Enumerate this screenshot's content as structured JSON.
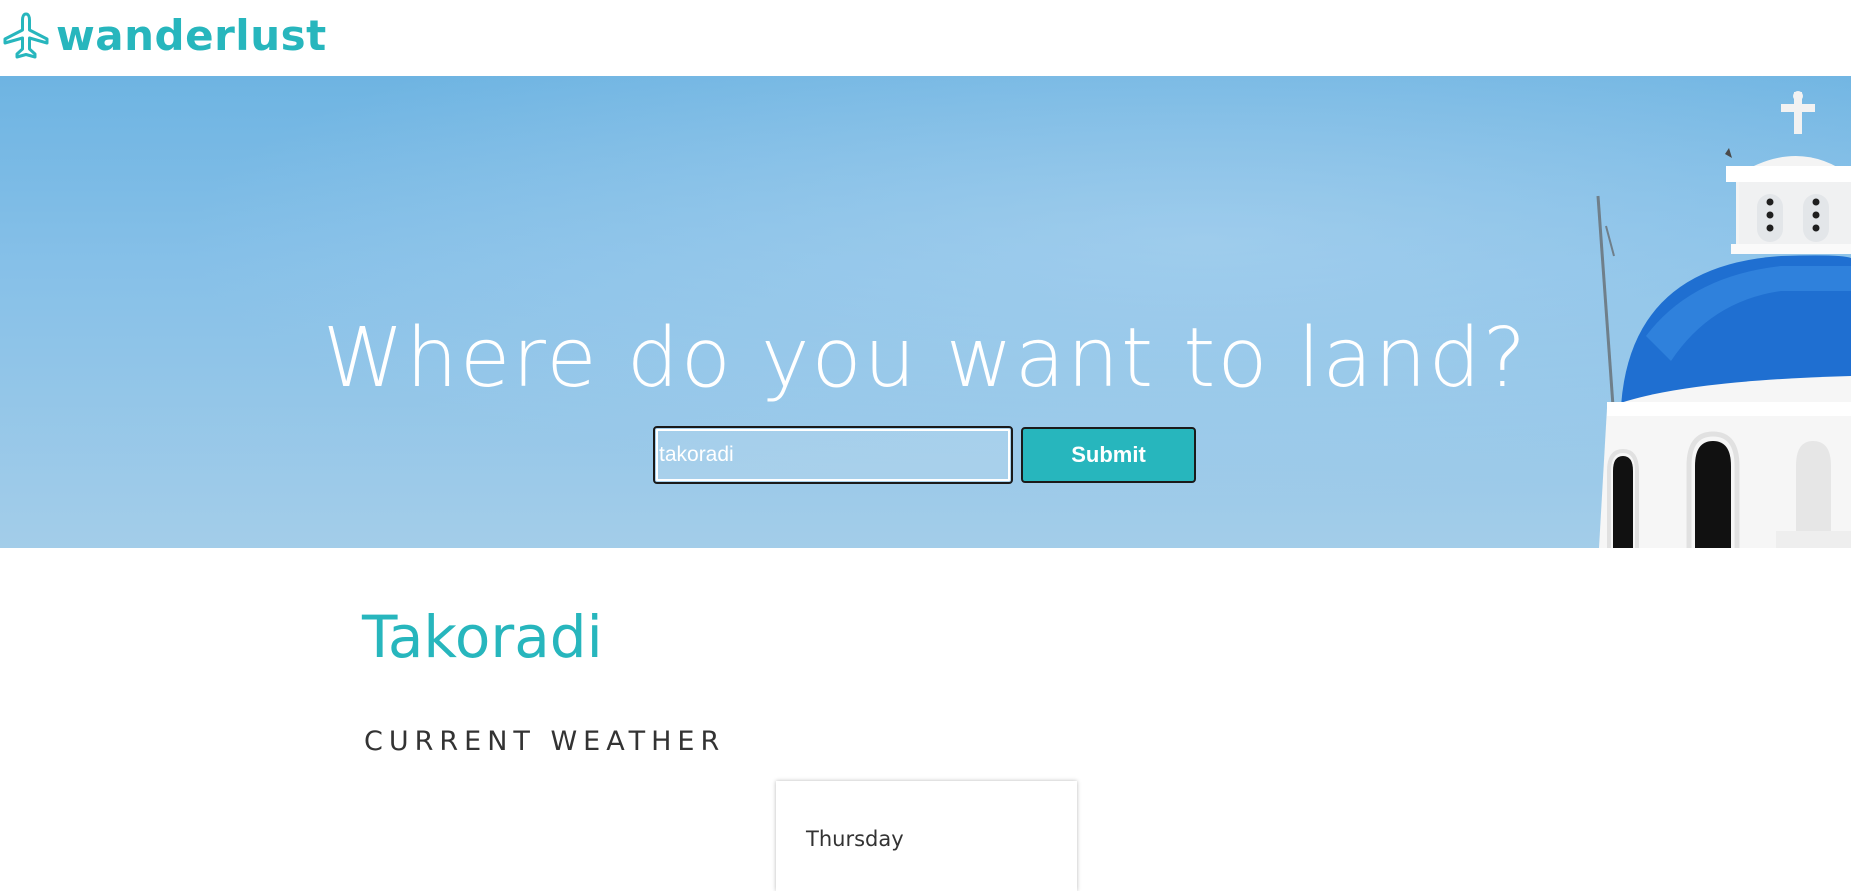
{
  "colors": {
    "accent": "#27b6bd",
    "text_dark": "#333333",
    "white": "#ffffff",
    "sky": "#6eb4e2",
    "dome_blue": "#1f6fd1"
  },
  "header": {
    "brand": "wanderlust",
    "logo_icon": "airplane-icon"
  },
  "hero": {
    "title": "Where do you want to land?",
    "search": {
      "value": "takoradi",
      "placeholder": ""
    },
    "submit_label": "Submit"
  },
  "results": {
    "city": "Takoradi",
    "section_heading": "CURRENT WEATHER",
    "weather_card": {
      "day": "Thursday"
    }
  }
}
